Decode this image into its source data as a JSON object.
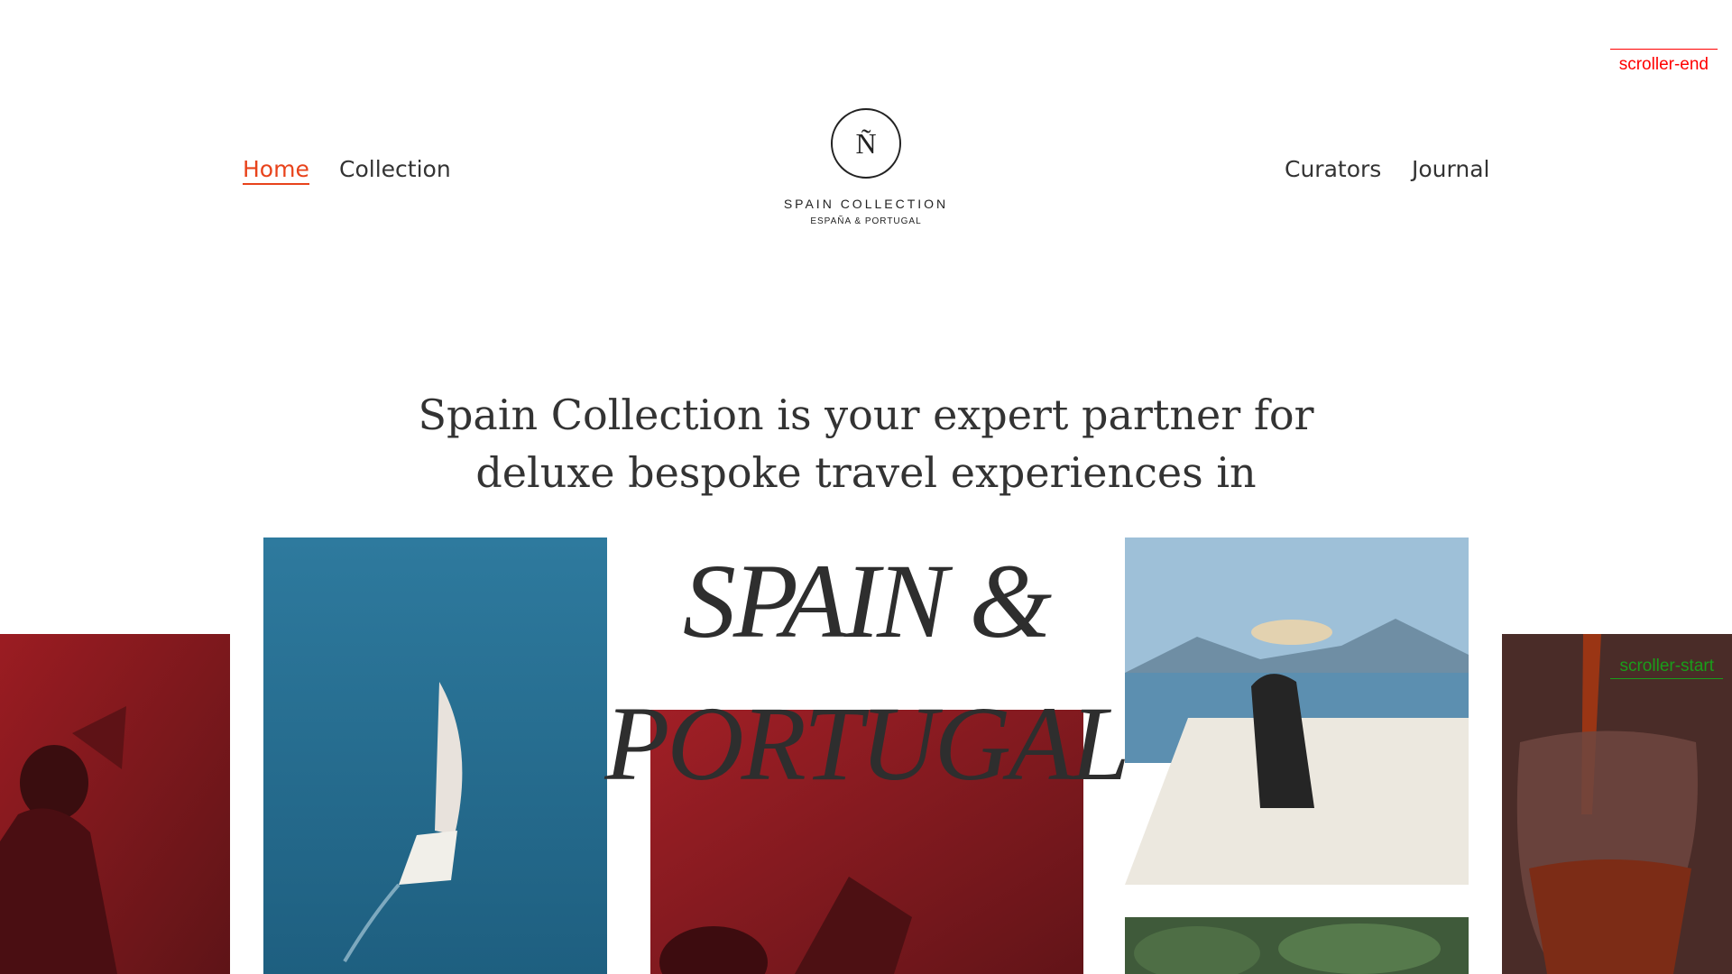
{
  "nav": {
    "left": [
      {
        "label": "Home",
        "active": true
      },
      {
        "label": "Collection",
        "active": false
      }
    ],
    "right": [
      {
        "label": "Curators"
      },
      {
        "label": "Journal"
      }
    ]
  },
  "logo": {
    "mark": "Ñ",
    "name": "SPAIN COLLECTION",
    "subtitle": "ESPAÑA & PORTUGAL"
  },
  "intro": {
    "line1": "Spain Collection is your expert partner for",
    "line2": "deluxe bespoke travel experiences in"
  },
  "headline": {
    "line1": "SPAIN &",
    "line2": "PORTUGAL"
  },
  "debug_markers": {
    "end": "scroller-end",
    "start": "scroller-start"
  },
  "colors": {
    "accent": "#e8431b",
    "text": "#2e2e2e",
    "marker_end": "#ff0000",
    "marker_start": "#1a9d1a"
  }
}
